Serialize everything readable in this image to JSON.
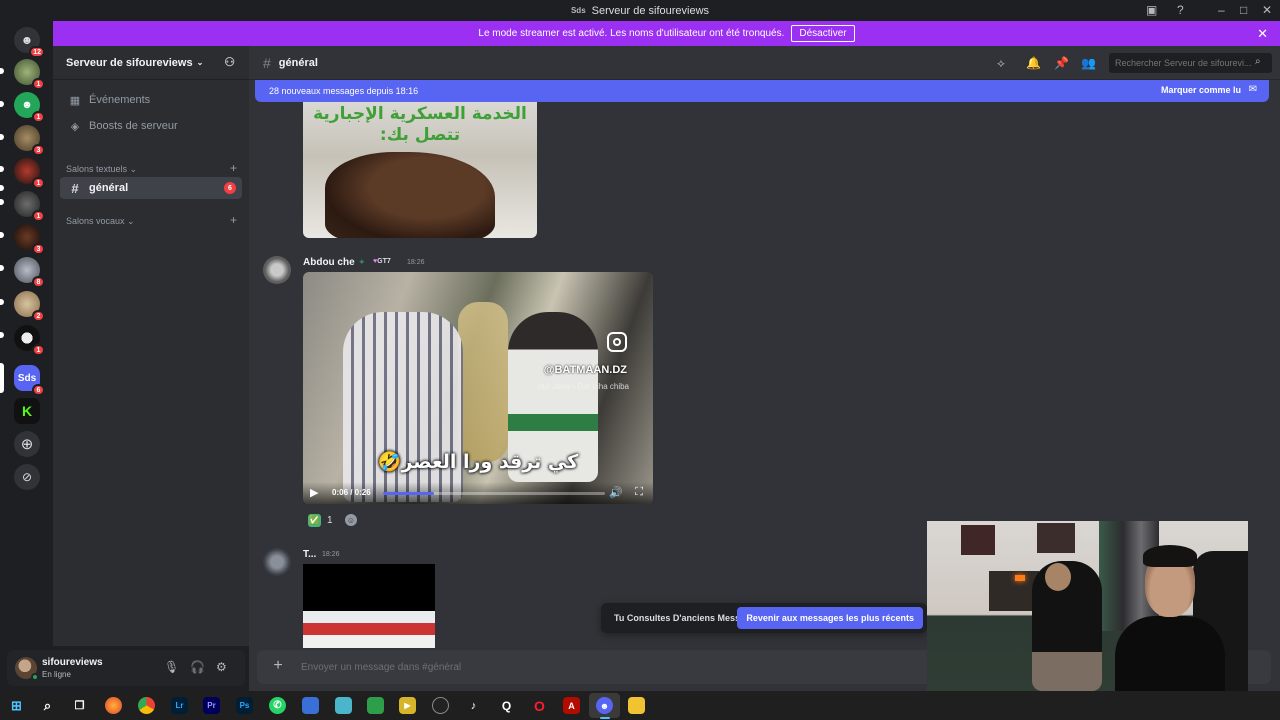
{
  "window": {
    "title_icon": "Sds",
    "title": "Serveur de sifoureviews"
  },
  "streamer_banner": {
    "message": "Le mode streamer est activé. Les noms d'utilisateur ont été tronqués.",
    "button": "Désactiver"
  },
  "rail": {
    "servers": [
      {
        "name": "home-discord-icon",
        "badge": "12"
      },
      {
        "name": "server-1",
        "badge": "1"
      },
      {
        "name": "server-2",
        "badge": "1"
      },
      {
        "name": "server-3",
        "badge": "3"
      },
      {
        "name": "server-4",
        "badge": "1"
      },
      {
        "name": "server-5",
        "badge": "1"
      },
      {
        "name": "server-6",
        "badge": "3"
      },
      {
        "name": "server-7",
        "badge": "8"
      },
      {
        "name": "server-8",
        "badge": "2"
      },
      {
        "name": "server-9",
        "badge": "1"
      },
      {
        "name": "server-sds",
        "label": "Sds",
        "badge": "6"
      },
      {
        "name": "server-kick",
        "label": "K",
        "badge": ""
      }
    ]
  },
  "sidebar": {
    "server_name": "Serveur de sifoureviews",
    "events": "Événements",
    "boosts": "Boosts de serveur",
    "text_category": "Salons textuels",
    "voice_category": "Salons vocaux",
    "channels": [
      {
        "name": "général",
        "unread": "6"
      }
    ]
  },
  "user_panel": {
    "name": "sifoureviews",
    "status": "En ligne"
  },
  "header": {
    "channel": "général",
    "search_placeholder": "Rechercher Serveur de sifourevi..."
  },
  "new_messages": {
    "text": "28 nouveaux messages depuis 18:16",
    "mark_read": "Marquer comme lu"
  },
  "messages": [
    {
      "image_text": "الخدمة العسكرية الإجبارية تتصل بك:"
    },
    {
      "author": "Abdou che",
      "tag": "GT7",
      "time": "18:26",
      "video": {
        "handle": "@BATMAAN.DZ",
        "subtitle": "rad Jaaw • Dor biha chiba",
        "caption": "كي ترقد ورا العصر🤣",
        "time": "0:06 / 0:26",
        "progress": 0.23
      },
      "reaction": {
        "emoji": "✅",
        "count": "1"
      }
    },
    {
      "author": "T...",
      "time": "18:26"
    }
  ],
  "jump_banner": {
    "text": "Tu Consultes D'anciens Messages",
    "button": "Revenir aux messages les plus récents"
  },
  "composer": {
    "placeholder": "Envoyer un message dans #général"
  },
  "taskbar": {
    "apps": [
      "windows-start",
      "search",
      "task-view",
      "firefox",
      "chrome",
      "lightroom",
      "premiere",
      "photoshop",
      "whatsapp",
      "app-blue",
      "app-teal",
      "app-green",
      "app-yellow",
      "app-obs",
      "tiktok",
      "app-q",
      "opera",
      "acrobat",
      "discord",
      "file-explorer"
    ]
  },
  "colors": {
    "accent": "#5865f2",
    "streamer": "#9b30f2",
    "unread": "#f23f43",
    "online": "#23a55a"
  }
}
